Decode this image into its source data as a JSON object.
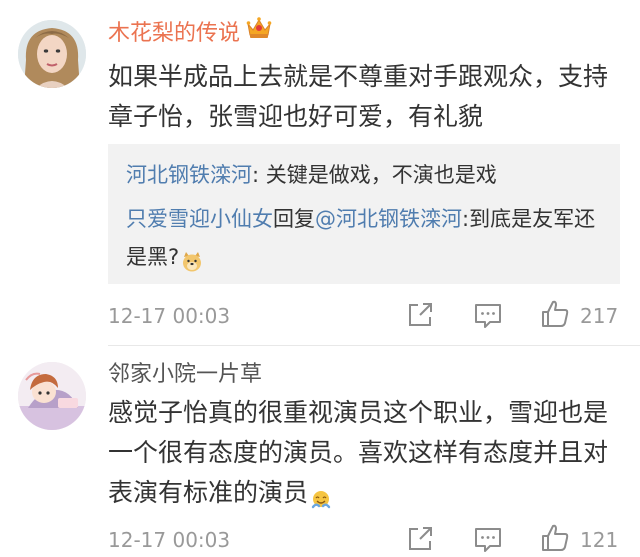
{
  "comments": [
    {
      "username": "木花梨的传说",
      "vip_icon": "crown-icon",
      "text": "如果半成品上去就是不尊重对手跟观众，支持章子怡，张雪迎也好可爱，有礼貌",
      "replies": [
        {
          "user": "河北钢铁滦河",
          "sep": ": ",
          "text": "关键是做戏，不演也是戏"
        },
        {
          "user": "只爱雪迎小仙女",
          "reply_word": "回复",
          "at": "@河北钢铁滦河",
          "sep": ":",
          "text": "到底是友军还是黑?",
          "emoji": "doge-emoji"
        }
      ],
      "time": "12-17 00:03",
      "like_count": "217"
    },
    {
      "username": "邻家小院一片草",
      "text": "感觉子怡真的很重视演员这个职业，雪迎也是一个很有态度的演员。喜欢这样有态度并且对表演有标准的演员",
      "emoji": "smile-emoji",
      "time": "12-17 00:03",
      "like_count": "121"
    }
  ],
  "colors": {
    "username_highlight": "#eb7350",
    "link": "#507daf",
    "reply_bg": "#f2f2f2",
    "meta": "#999999"
  }
}
